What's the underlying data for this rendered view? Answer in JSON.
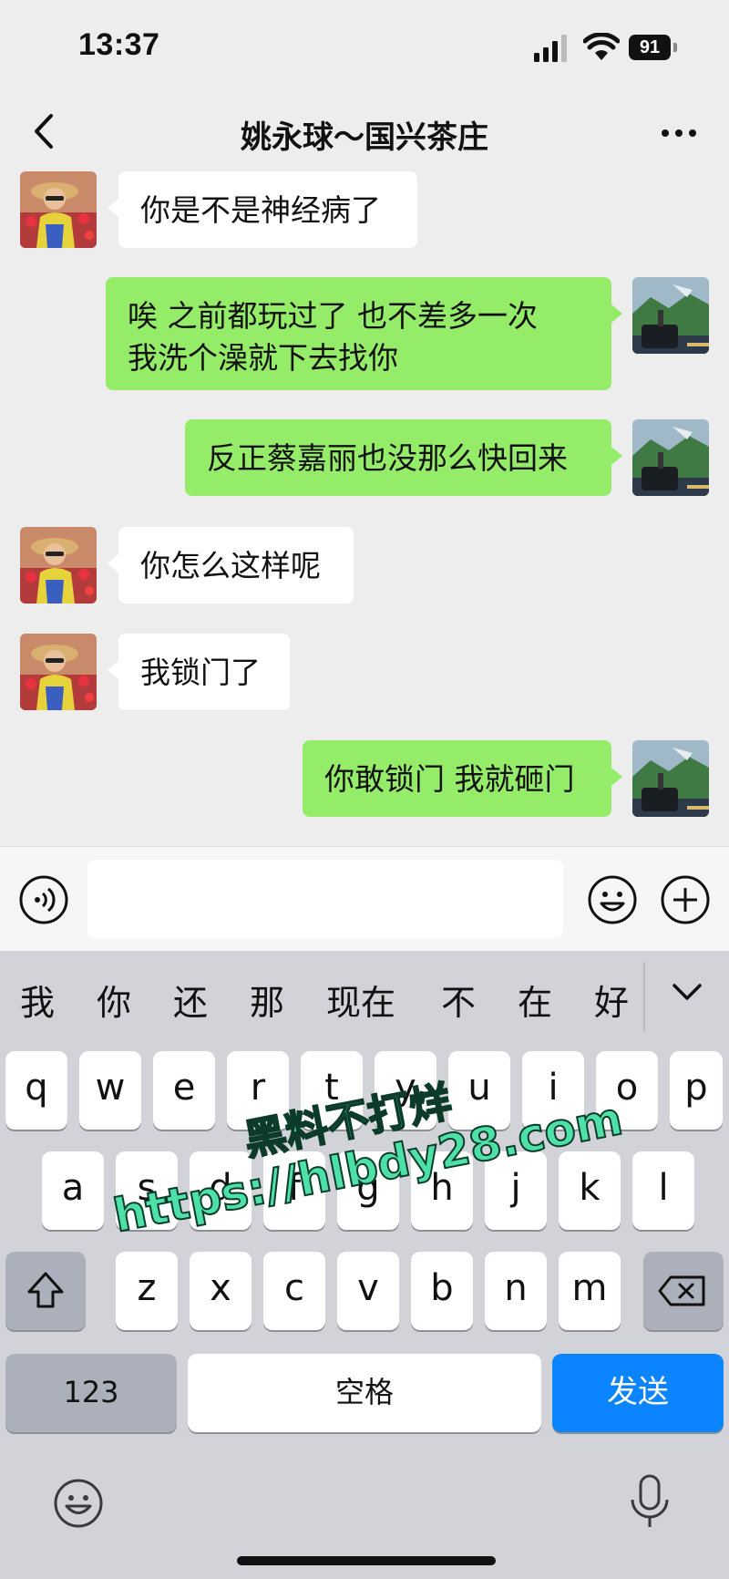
{
  "status_bar": {
    "time": "13:37",
    "battery": "91"
  },
  "header": {
    "title": "姚永球～国兴茶庄"
  },
  "messages": [
    {
      "side": "in",
      "text": "你是不是神经病了"
    },
    {
      "side": "out",
      "line1": "唉 之前都玩过了 也不差多一次",
      "line2": "我洗个澡就下去找你"
    },
    {
      "side": "out",
      "text": "反正蔡嘉丽也没那么快回来"
    },
    {
      "side": "in",
      "text": "你怎么这样呢"
    },
    {
      "side": "in",
      "text": "我锁门了"
    },
    {
      "side": "out",
      "text": "你敢锁门 我就砸门"
    }
  ],
  "keyboard": {
    "candidates": [
      "我",
      "你",
      "还",
      "那",
      "现在",
      "不",
      "在",
      "好"
    ],
    "row1": [
      "q",
      "w",
      "e",
      "r",
      "t",
      "y",
      "u",
      "i",
      "o",
      "p"
    ],
    "row2": [
      "a",
      "s",
      "d",
      "f",
      "g",
      "h",
      "j",
      "k",
      "l"
    ],
    "row3": [
      "z",
      "x",
      "c",
      "v",
      "b",
      "n",
      "m"
    ],
    "num_label": "123",
    "space_label": "空格",
    "send_label": "发送",
    "send_color": "#0a84ff"
  },
  "colors": {
    "outgoing_bubble": "#95ec69",
    "incoming_bubble": "#ffffff",
    "background": "#ededed"
  },
  "watermark": {
    "line1": "黑料不打烊",
    "line2": "https://hlbdy28.com"
  }
}
